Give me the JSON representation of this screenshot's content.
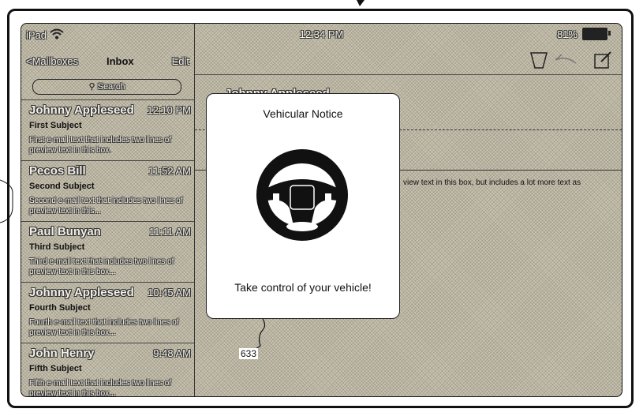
{
  "status_bar": {
    "device": "iPad",
    "time": "12:34 PM",
    "battery": "81%"
  },
  "nav": {
    "back_label": "<Mailboxes",
    "title": "Inbox",
    "edit_label": "Edit"
  },
  "search": {
    "placeholder": "Search"
  },
  "emails": [
    {
      "sender": "Johnny Appleseed",
      "time": "12:10 PM",
      "subject": "First Subject",
      "preview": "First e-mail text that includes two lines of preview text in this box."
    },
    {
      "sender": "Pecos Bill",
      "time": "11:52 AM",
      "subject": "Second Subject",
      "preview": "Second e-mail text that includes two lines of preview text in this..."
    },
    {
      "sender": "Paul Bunyan",
      "time": "11:11 AM",
      "subject": "Third Subject",
      "preview": "Third e-mail text that includes two lines of preview text in this box..."
    },
    {
      "sender": "Johnny Appleseed",
      "time": "10:45 AM",
      "subject": "Fourth Subject",
      "preview": "Fourth e-mail text that includes two lines of preview text in this box..."
    },
    {
      "sender": "John Henry",
      "time": "9:48 AM",
      "subject": "Fifth Subject",
      "preview": "Fifth e-mail text that includes two lines of preview text in this box..."
    }
  ],
  "detail": {
    "sender_partial": "Johnny Appleseed",
    "body_partial": "view text in this box, but includes a lot more text as"
  },
  "modal": {
    "title": "Vehicular Notice",
    "message": "Take control of your vehicle!",
    "icon": "steering-wheel-icon"
  },
  "reference_label": "633"
}
